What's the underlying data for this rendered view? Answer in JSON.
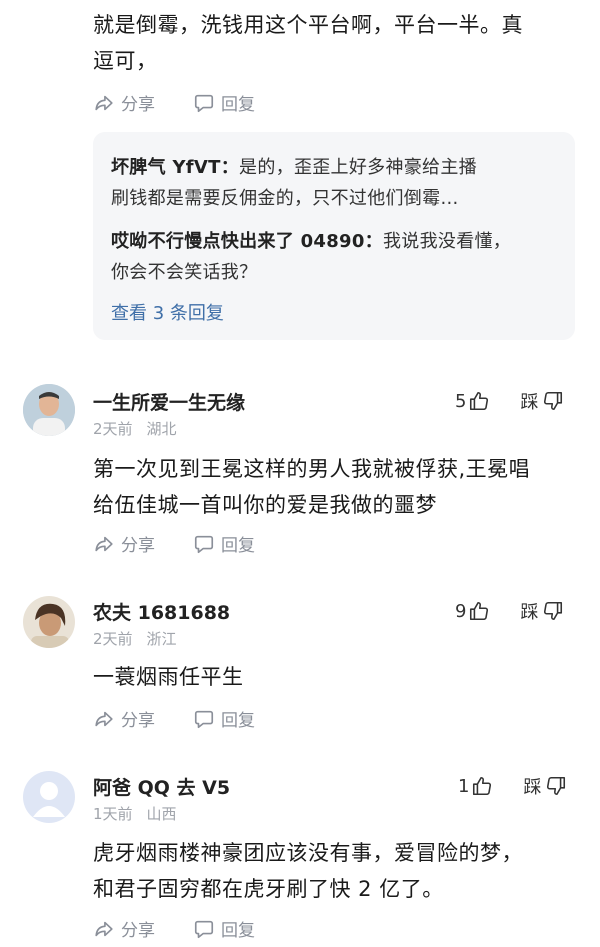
{
  "top_comment": {
    "text_line1": "就是倒霉，洗钱用这个平台啊，平台一半。真",
    "text_line2": "逗可，",
    "share_label": "分享",
    "reply_label": "回复"
  },
  "replies_box": {
    "reply1": {
      "author": "坏脾气 YfVT：",
      "line1": "是的，歪歪上好多神豪给主播",
      "line2": "刷钱都是需要反佣金的，只不过他们倒霉…"
    },
    "reply2": {
      "author": "哎呦不行慢点快出来了 04890：",
      "line1": "我说我没看懂，",
      "line2": "你会不会笑话我？"
    },
    "view_more": "查看 3 条回复"
  },
  "comments": [
    {
      "username": "一生所爱一生无缘",
      "time": "2天前",
      "location": "湖北",
      "likes": "5",
      "dislike_label": "踩",
      "line1": "第一次见到王冕这样的男人我就被俘获,王冕唱",
      "line2": "给伍佳城一首叫你的爱是我做的噩梦",
      "share_label": "分享",
      "reply_label": "回复"
    },
    {
      "username": "农夫 1681688",
      "time": "2天前",
      "location": "浙江",
      "likes": "9",
      "dislike_label": "踩",
      "line1": "一蓑烟雨任平生",
      "line2": "",
      "share_label": "分享",
      "reply_label": "回复"
    },
    {
      "username": "阿爸 QQ 去 V5",
      "time": "1天前",
      "location": "山西",
      "likes": "1",
      "dislike_label": "踩",
      "line1": "虎牙烟雨楼神豪团应该没有事，爱冒险的梦，",
      "line2": "和君子固穷都在虎牙刷了快 2 亿了。",
      "share_label": "分享",
      "reply_label": "回复"
    }
  ],
  "icons": [
    "share-icon",
    "reply-icon",
    "thumb-up-icon",
    "thumb-down-icon",
    "avatar"
  ]
}
